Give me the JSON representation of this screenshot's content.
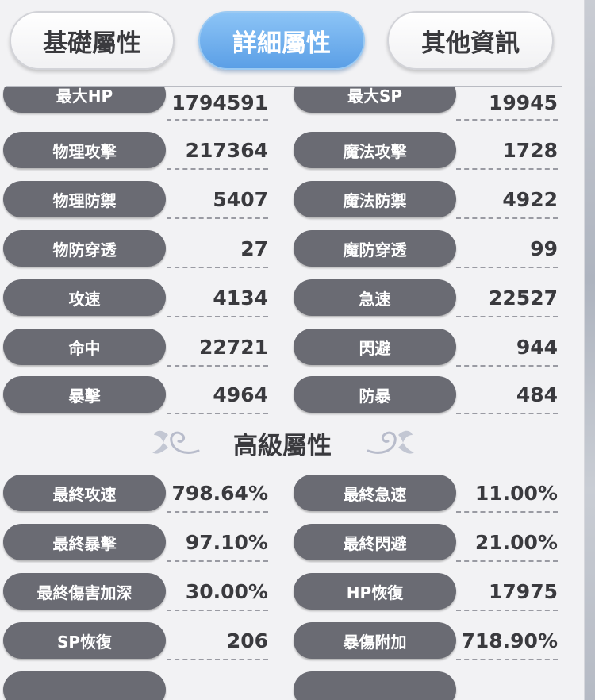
{
  "tabs": [
    {
      "label": "基礎屬性",
      "active": false
    },
    {
      "label": "詳細屬性",
      "active": true
    },
    {
      "label": "其他資訊",
      "active": false
    }
  ],
  "stats_left": [
    {
      "label": "最大HP",
      "value": "1794591"
    },
    {
      "label": "物理攻擊",
      "value": "217364"
    },
    {
      "label": "物理防禦",
      "value": "5407"
    },
    {
      "label": "物防穿透",
      "value": "27"
    },
    {
      "label": "攻速",
      "value": "4134"
    },
    {
      "label": "命中",
      "value": "22721"
    },
    {
      "label": "暴擊",
      "value": "4964"
    }
  ],
  "stats_right": [
    {
      "label": "最大SP",
      "value": "19945"
    },
    {
      "label": "魔法攻擊",
      "value": "1728"
    },
    {
      "label": "魔法防禦",
      "value": "4922"
    },
    {
      "label": "魔防穿透",
      "value": "99"
    },
    {
      "label": "急速",
      "value": "22527"
    },
    {
      "label": "閃避",
      "value": "944"
    },
    {
      "label": "防暴",
      "value": "484"
    }
  ],
  "advanced_title": "高級屬性",
  "advanced_left": [
    {
      "label": "最終攻速",
      "value": "798.64%"
    },
    {
      "label": "最終暴擊",
      "value": "97.10%"
    },
    {
      "label": "最終傷害加深",
      "value": "30.00%"
    },
    {
      "label": "SP恢復",
      "value": "206"
    }
  ],
  "advanced_right": [
    {
      "label": "最終急速",
      "value": "11.00%"
    },
    {
      "label": "最終閃避",
      "value": "21.00%"
    },
    {
      "label": "HP恢復",
      "value": "17975"
    },
    {
      "label": "暴傷附加",
      "value": "718.90%"
    }
  ],
  "colors": {
    "tab_active": "#5b9fe6",
    "label_pill": "#6a6b73",
    "value_text": "#3a3a3e"
  }
}
